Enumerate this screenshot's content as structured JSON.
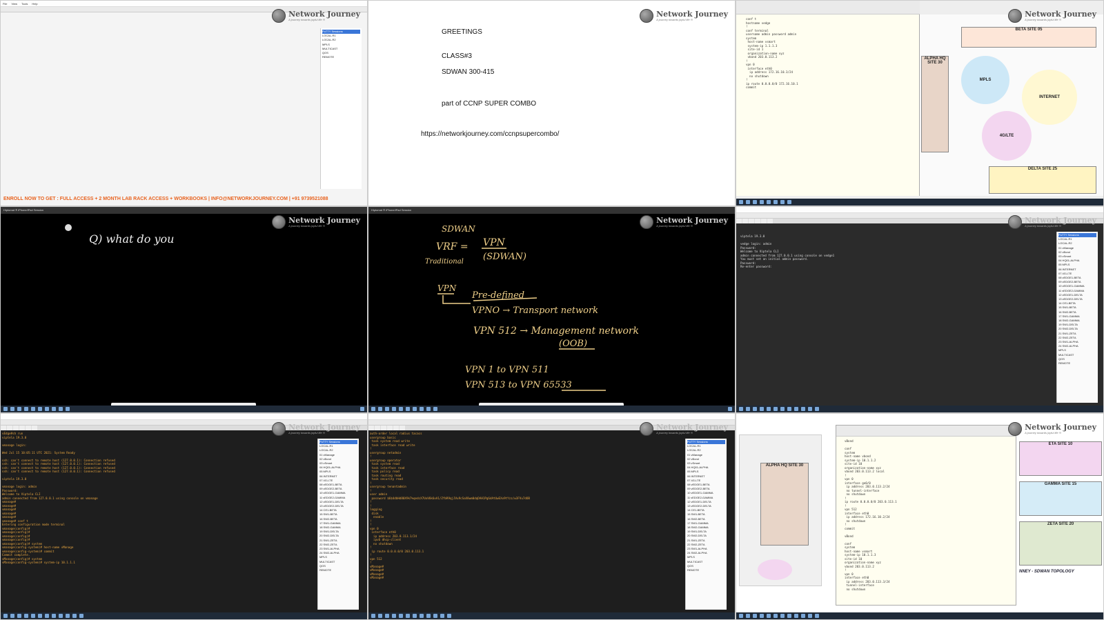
{
  "brand": {
    "name": "Network Journey",
    "tagline": "A journey towards joyful life !!!"
  },
  "tile1": {
    "menu": [
      "File",
      "View",
      "Tools",
      "Help"
    ],
    "tree_title": "PuTTY Sessions",
    "tree_items": [
      "LOCAL-R1",
      "LOCAL-R2",
      "MPLS",
      "MULTICAST",
      "QOS",
      "REMOTE"
    ],
    "banner": "ENROLL NOW TO GET : FULL ACCESS + 2 MONTH LAB RACK ACCESS + WORKBOOKS | INFO@NETWORKJOURNEY.COM | +91 9739521088"
  },
  "tile2": {
    "greeting": "GREETINGS",
    "class": "CLASS#3",
    "course": "SDWAN 300-415",
    "part": "part of CCNP SUPER COMBO",
    "url": "https://networkjourney.com/ccnpsupercombo/"
  },
  "tile3": {
    "code_lines": [
      "conf t",
      "hostname vedge",
      "!",
      "conf terminal",
      "username admin password admin",
      "system",
      " host-name vsmart",
      " system-ip 1.1.1.3",
      " site-id 1",
      " organization-name xyz",
      " vbond 203.0.113.2",
      "!",
      "vpn 0",
      " interface eth0",
      "  ip address 172.16.10.3/24",
      "  no shutdown",
      "!",
      "ip route 0.0.0.0/0 172.16.10.1",
      "commit"
    ],
    "sites": [
      "BETA SITE 05",
      "ALPHA HQ SITE 30",
      "DELTA SITE 25"
    ],
    "clouds": [
      "MPLS",
      "INTERNET",
      "4G/LTE"
    ]
  },
  "tile4": {
    "title": "Hiptomat ® iPhone/iPad Session",
    "handwriting": "Q) what do you"
  },
  "tile5": {
    "title": "Hiptomat ® iPhone/iPad Session",
    "lines": [
      "SDWAN",
      "VRF =",
      "VPN",
      "(SDWAN)",
      "Traditional",
      "VPN",
      "Pre-defined",
      "VPNO  →  Transport network",
      "VPN 512  →  Management network",
      "(OOB)",
      "VPN 1 to VPN 511",
      "VPN 513 to VPN 65533"
    ]
  },
  "tile6": {
    "console": [
      "viptela 19.3.0",
      "",
      "vedge login: admin",
      "Password:",
      "Welcome to Viptela CLI",
      "admin connected from 127.0.0.1 using console on vedge1",
      "You must set an initial admin password.",
      "Password:",
      "Re-enter password: "
    ],
    "tree_items": [
      "PuTTY Sessions",
      "LOCAL-R1",
      "LOCAL-R2",
      "01 vManage",
      "02 vBond",
      "03 vSmart",
      "04 HQ01-ALPHA",
      "05 MPLS",
      "06 INTERNET",
      "07 4G-LTE",
      "08 vEDGE1-BETA",
      "09 vEDGE2-BETA",
      "10 vEDGE1-GAMMA",
      "11 vEDGE2-GAMMA",
      "12 vEDGE1-DELTA",
      "13 vEDGE2-DELTA",
      "14 CE1-BETA",
      "15 SW1-BETA",
      "16 SW2-BETA",
      "17 SW1-GAMMA",
      "18 SW2-GAMMA",
      "19 SW1-DELTA",
      "20 SW2-DELTA",
      "21 SW1-ZETA",
      "22 SW2-ZETA",
      "23 SW1-ALPHA",
      "24 SW2-ALPHA",
      "MPLS",
      "MULTICAST",
      "QOS",
      "REMOTE"
    ]
  },
  "tile7": {
    "console": [
      "vEdge#sh run",
      "viptela 19.3.0",
      "",
      "vmanage login:",
      "",
      "Wed Jul 15 10:05:11 UTC 2021: System Ready",
      "",
      "ssh: can't connect to remote host (127.0.0.1): Connection refused",
      "ssh: can't connect to remote host (127.0.0.1): Connection refused",
      "ssh: can't connect to remote host (127.0.0.1): Connection refused",
      "ssh: can't connect to remote host (127.0.0.1): Connection refused",
      "",
      "viptela 19.3.0",
      "",
      "vmanage login: admin",
      "Password:",
      "Welcome to Viptela CLI",
      "admin connected from 127.0.0.1 using console on vmanage",
      "vmanage#",
      "vmanage#",
      "vmanage#",
      "vmanage#",
      "vmanage#",
      "vmanage# conf t",
      "Entering configuration mode terminal",
      "vmanage(config)#",
      "vmanage(config)#",
      "vmanage(config)#",
      "vmanage(config)#",
      "vmanage(config)# system",
      "vmanage(config-system)# host-name vManage",
      "vmanage(config-system)# commit",
      "Commit complete.",
      "vManage(config)# system",
      "vManage(config-system)# system-ip 10.1.1.1"
    ],
    "tree_items": [
      "PuTTY Sessions",
      "LOCAL-R1",
      "LOCAL-R2",
      "01 vManage",
      "02 vBond",
      "03 vSmart",
      "04 HQ01-ALPHA",
      "05 MPLS",
      "06 INTERNET",
      "07 4G-LTE",
      "08 vEDGE1-BETA",
      "09 vEDGE2-BETA",
      "10 vEDGE1-GAMMA",
      "11 vEDGE2-GAMMA",
      "12 vEDGE1-DELTA",
      "13 vEDGE2-DELTA",
      "14 CE1-BETA",
      "15 SW1-BETA",
      "16 SW2-BETA",
      "17 SW1-GAMMA",
      "18 SW2-GAMMA",
      "19 SW1-DELTA",
      "20 SW2-DELTA",
      "21 SW1-ZETA",
      "22 SW2-ZETA",
      "23 SW1-ALPHA",
      "24 SW2-ALPHA",
      "MPLS",
      "MULTICAST",
      "QOS",
      "REMOTE"
    ]
  },
  "tile8": {
    "console": [
      "auth-order local radius tacacs",
      "usergroup basic",
      " task system read write",
      " task interface read write",
      "!",
      "usergroup netadmin",
      "!",
      "usergroup operator",
      " task system read",
      " task interface read",
      " task policy read",
      " task routing read",
      " task security read",
      "!",
      "usergroup tenantadmin",
      "!",
      "user admin",
      " password $6$4dbHd80X9k7%qedcX7UoV6k6xA1/ZfbR9qjJVu9cSaX8wm0dqDAH1Pg6dAtUwEXx9tYzz/w3FVu7dOB",
      "!",
      "!",
      "logging",
      " disk",
      "  enable",
      "!",
      "!",
      "vpn 0",
      " interface eth0",
      "  ip address 203.0.113.1/24",
      "  ipv6 dhcp-client",
      "  no shutdown",
      "!",
      " ip route 0.0.0.0/0 203.0.113.1",
      "!",
      "vpn 512",
      "!",
      "vManage#",
      "vManage#",
      "vManage#",
      "vManage# "
    ],
    "tree_items": [
      "PuTTY Sessions",
      "LOCAL-R1",
      "LOCAL-R2",
      "01 vManage",
      "02 vBond",
      "03 vSmart",
      "04 HQ01-ALPHA",
      "05 MPLS",
      "06 INTERNET",
      "07 4G-LTE",
      "08 vEDGE1-BETA",
      "09 vEDGE2-BETA",
      "10 vEDGE1-GAMMA",
      "11 vEDGE2-GAMMA",
      "12 vEDGE1-DELTA",
      "13 vEDGE2-DELTA",
      "14 CE1-BETA",
      "15 SW1-BETA",
      "16 SW2-BETA",
      "17 SW1-GAMMA",
      "18 SW2-GAMMA",
      "19 SW1-DELTA",
      "20 SW2-DELTA",
      "21 SW1-ZETA",
      "22 SW2-ZETA",
      "23 SW1-ALPHA",
      "24 SW2-ALPHA",
      "MPLS",
      "MULTICAST",
      "QOS",
      "REMOTE"
    ]
  },
  "tile9": {
    "code_lines": [
      "vBond",
      "",
      "conf",
      "system",
      "host-name vbond",
      "system-ip 10.1.1.2",
      "site-id 10",
      "organization-name xyz",
      "vbond 203.0.113.2 local",
      "!",
      "vpn 0",
      "interface ge0/0",
      " ip address 203.0.113.2/24",
      " no tunnel-interface",
      " no shutdown",
      "!",
      "ip route 0.0.0.0/0 203.0.113.1",
      "!",
      "vpn 512",
      "interface eth0",
      " ip address 172.16.10.2/24",
      " no shutdown",
      "!",
      "commit",
      "",
      "vBond",
      "",
      "conf",
      "system",
      "host-name vsmart",
      "system-ip 10.1.1.3",
      "site-id 10",
      "organization-name xyz",
      "vbond 203.0.113.2",
      "!",
      "vpn 0",
      "interface eth0",
      " ip address 203.0.113.3/24",
      " tunnel-interface",
      " no shutdown"
    ],
    "sites": [
      "ETA SITE 10",
      "GAMMA SITE 15",
      "ZETA SITE 20",
      "ALPHA HQ SITE 30"
    ],
    "footer": "NNEY - SDWAN TOPOLOGY"
  }
}
